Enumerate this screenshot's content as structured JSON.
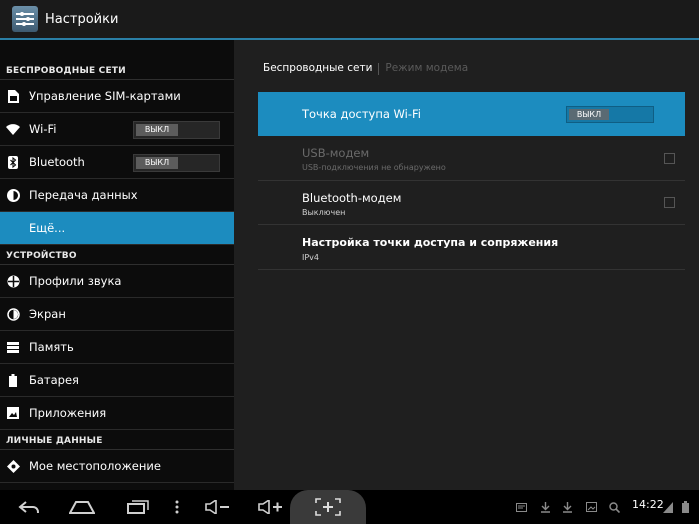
{
  "header": {
    "title": "Настройки"
  },
  "sidebar": {
    "sections": {
      "wireless": "БЕСПРОВОДНЫЕ СЕТИ",
      "device": "УСТРОЙСТВО",
      "personal": "ЛИЧНЫЕ ДАННЫЕ"
    },
    "items": [
      {
        "label": "Управление SIM-картами",
        "icon": "sim-card-icon"
      },
      {
        "label": "Wi-Fi",
        "icon": "wifi-icon",
        "toggle": "ВЫКЛ"
      },
      {
        "label": "Bluetooth",
        "icon": "bluetooth-icon",
        "toggle": "ВЫКЛ"
      },
      {
        "label": "Передача данных",
        "icon": "data-usage-icon"
      },
      {
        "label": "Ещё...",
        "selected": true
      },
      {
        "label": "Профили звука",
        "icon": "sound-icon"
      },
      {
        "label": "Экран",
        "icon": "display-icon"
      },
      {
        "label": "Память",
        "icon": "storage-icon"
      },
      {
        "label": "Батарея",
        "icon": "battery-icon"
      },
      {
        "label": "Приложения",
        "icon": "apps-icon"
      },
      {
        "label": "Мое местоположение",
        "icon": "location-icon"
      }
    ]
  },
  "main": {
    "tabs": [
      {
        "label": "Беспроводные сети",
        "active": true
      },
      {
        "label": "Режим модема",
        "active": false
      }
    ],
    "prefs": [
      {
        "title": "Точка доступа Wi-Fi",
        "toggle": "ВЫКЛ",
        "highlighted": true
      },
      {
        "title": "USB-модем",
        "summary": "USB-подключения не обнаружено",
        "enabled": false
      },
      {
        "title": "Bluetooth-модем",
        "summary": "Выключен",
        "enabled": true
      },
      {
        "title": "Настройка точки доступа и сопряжения",
        "summary": "IPv4"
      }
    ]
  },
  "navbar": {
    "time": "14:22"
  },
  "colors": {
    "accent": "#1c8cbf",
    "background": "#1f1f1f",
    "sidebar": "#0c0c0c"
  }
}
